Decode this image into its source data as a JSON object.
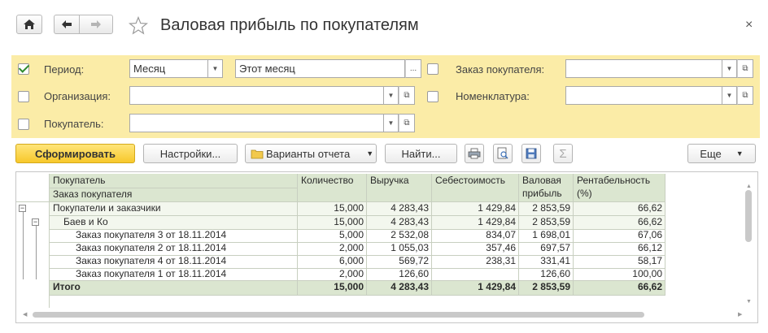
{
  "window": {
    "title": "Валовая прибыль по покупателям",
    "close_glyph": "×"
  },
  "filters": {
    "period": {
      "label": "Период:",
      "checked": true,
      "type_value": "Месяц",
      "range_value": "Этот месяц"
    },
    "organization": {
      "label": "Организация:",
      "checked": false,
      "value": ""
    },
    "customer": {
      "label": "Покупатель:",
      "checked": false,
      "value": ""
    },
    "customer_order": {
      "label": "Заказ покупателя:",
      "checked": false,
      "value": ""
    },
    "nomenclature": {
      "label": "Номенклатура:",
      "checked": false,
      "value": ""
    }
  },
  "toolbar": {
    "generate_label": "Сформировать",
    "settings_label": "Настройки...",
    "variants_label": "Варианты отчета",
    "find_label": "Найти...",
    "more_label": "Еще"
  },
  "report": {
    "headers": {
      "customer": "Покупатель",
      "order": "Заказ покупателя",
      "quantity": "Количество",
      "revenue": "Выручка",
      "cost": "Себестоимость",
      "gross_profit_1": "Валовая",
      "gross_profit_2": "прибыль",
      "profitability_1": "Рентабельность",
      "profitability_2": "(%)"
    },
    "rows": [
      {
        "name": "Покупатели и заказчики",
        "quantity": "15,000",
        "revenue": "4 283,43",
        "cost": "1 429,84",
        "gross": "2 853,59",
        "profit": "66,62"
      },
      {
        "name": "Баев и Ко",
        "quantity": "15,000",
        "revenue": "4 283,43",
        "cost": "1 429,84",
        "gross": "2 853,59",
        "profit": "66,62"
      },
      {
        "name": "Заказ покупателя 3 от 18.11.2014",
        "quantity": "5,000",
        "revenue": "2 532,08",
        "cost": "834,07",
        "gross": "1 698,01",
        "profit": "67,06"
      },
      {
        "name": "Заказ покупателя 2 от 18.11.2014",
        "quantity": "2,000",
        "revenue": "1 055,03",
        "cost": "357,46",
        "gross": "697,57",
        "profit": "66,12"
      },
      {
        "name": "Заказ покупателя 4 от 18.11.2014",
        "quantity": "6,000",
        "revenue": "569,72",
        "cost": "238,31",
        "gross": "331,41",
        "profit": "58,17"
      },
      {
        "name": "Заказ покупателя 1 от 18.11.2014",
        "quantity": "2,000",
        "revenue": "126,60",
        "cost": "",
        "gross": "126,60",
        "profit": "100,00"
      }
    ],
    "total": {
      "name": "Итого",
      "quantity": "15,000",
      "revenue": "4 283,43",
      "cost": "1 429,84",
      "gross": "2 853,59",
      "profit": "66,62"
    }
  },
  "icons": {
    "home": "home-icon",
    "back": "arrow-left-icon",
    "forward": "arrow-right-icon",
    "favorite": "star-icon",
    "print": "printer-icon",
    "preview": "print-preview-icon",
    "save": "floppy-disk-icon",
    "sum": "sigma-icon"
  },
  "colors": {
    "filter_panel": "#fbeca7",
    "primary_button": "#f7c82b",
    "header_bg": "#dbe6d0",
    "group_row_bg": "#f3f7ee"
  }
}
